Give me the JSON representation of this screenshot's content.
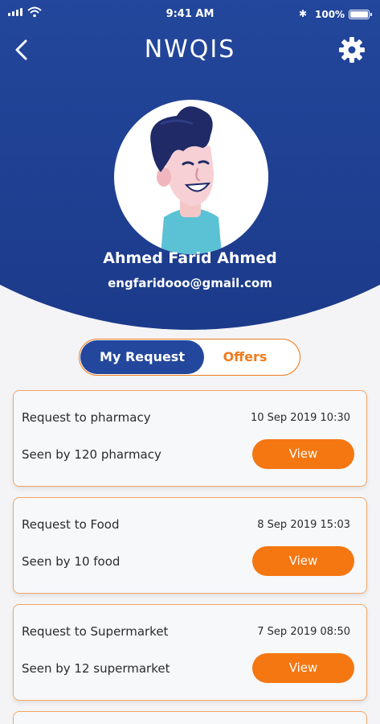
{
  "status_bar": {
    "time": "9:41 AM",
    "battery": "100%"
  },
  "nav": {
    "title": "NWQIS",
    "back_icon": "chevron-left-icon",
    "settings_icon": "gear-icon"
  },
  "profile": {
    "name": "Ahmed Farid Ahmed",
    "email": "engfaridooo@gmail.com"
  },
  "tabs": [
    {
      "label": "My Request",
      "active": true
    },
    {
      "label": "Offers",
      "active": false
    }
  ],
  "requests": [
    {
      "title": "Request to pharmacy",
      "date": "10 Sep 2019 10:30",
      "seen": "Seen by 120 pharmacy",
      "action": "View"
    },
    {
      "title": "Request to Food",
      "date": "8 Sep 2019 15:03",
      "seen": "Seen by 10 food",
      "action": "View"
    },
    {
      "title": "Request to Supermarket",
      "date": "7 Sep 2019 08:50",
      "seen": "Seen by 12 supermarket",
      "action": "View"
    }
  ],
  "colors": {
    "primary": "#23479c",
    "accent": "#f57711",
    "border": "#f2a565"
  }
}
